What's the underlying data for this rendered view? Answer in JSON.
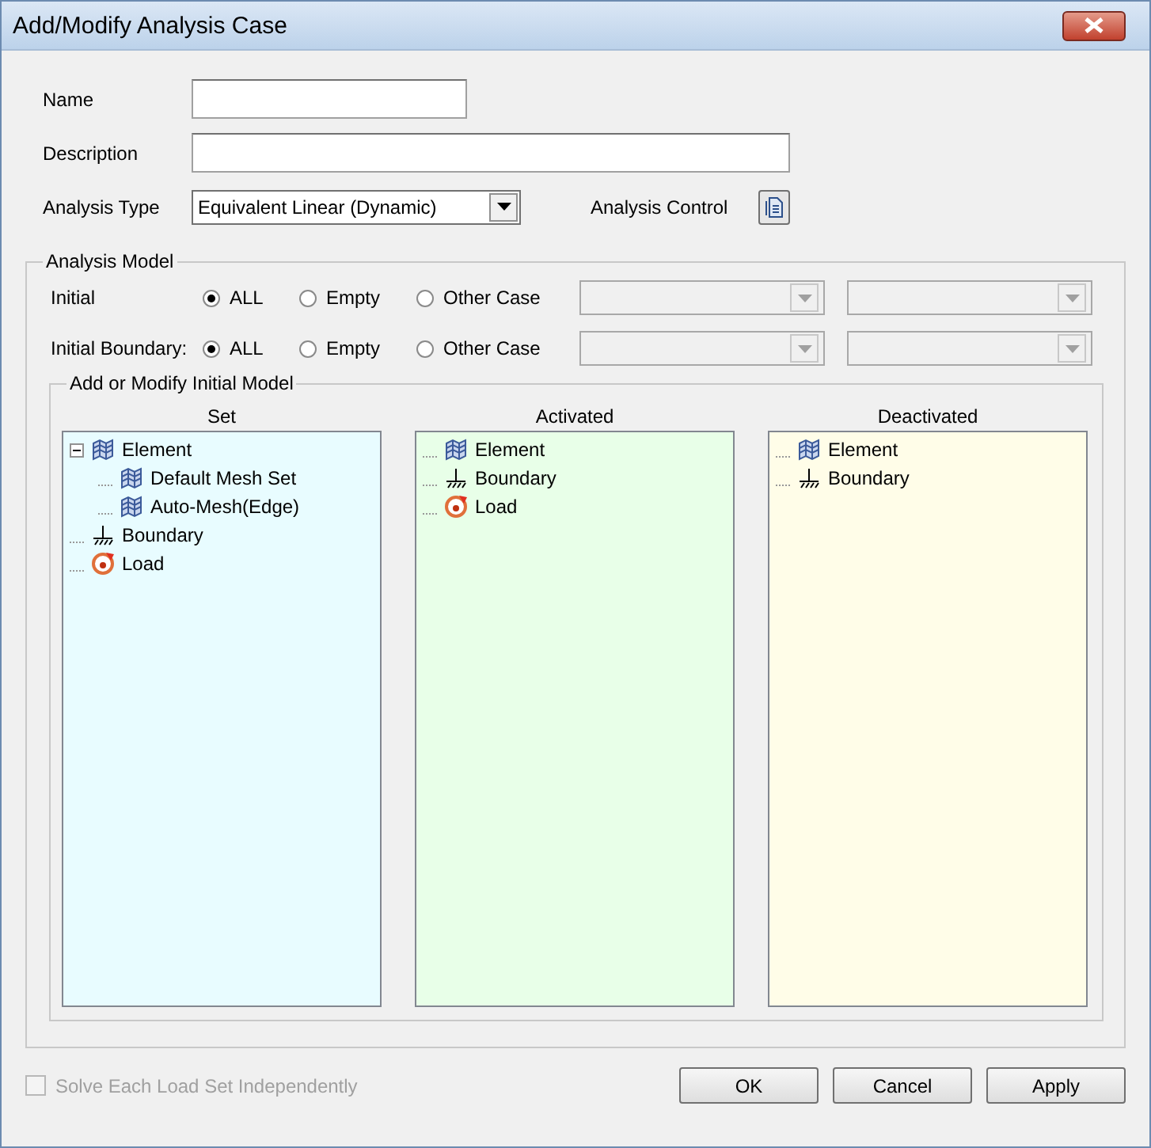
{
  "window": {
    "title": "Add/Modify Analysis Case"
  },
  "name_field": {
    "label": "Name"
  },
  "description_field": {
    "label": "Description"
  },
  "analysis_type": {
    "label": "Analysis Type",
    "value": "Equivalent Linear (Dynamic)"
  },
  "analysis_control": {
    "label": "Analysis Control"
  },
  "analysis_model": {
    "title": "Analysis Model",
    "rows": [
      {
        "label": "Initial",
        "options": [
          {
            "label": "ALL",
            "selected": true
          },
          {
            "label": "Empty",
            "selected": false
          },
          {
            "label": "Other Case",
            "selected": false
          }
        ]
      },
      {
        "label": "Initial Boundary:",
        "options": [
          {
            "label": "ALL",
            "selected": true
          },
          {
            "label": "Empty",
            "selected": false
          },
          {
            "label": "Other Case",
            "selected": false
          }
        ]
      }
    ]
  },
  "initial_model": {
    "title": "Add or Modify Initial Model",
    "panels": [
      {
        "title": "Set",
        "color": "#e8fcff",
        "items": [
          {
            "label": "Element",
            "kind": "element",
            "expanded": true,
            "children": [
              {
                "label": "Default Mesh Set",
                "kind": "element"
              },
              {
                "label": "Auto-Mesh(Edge)",
                "kind": "element"
              }
            ]
          },
          {
            "label": "Boundary",
            "kind": "boundary"
          },
          {
            "label": "Load",
            "kind": "load"
          }
        ]
      },
      {
        "title": "Activated",
        "color": "#e8ffe8",
        "items": [
          {
            "label": "Element",
            "kind": "element"
          },
          {
            "label": "Boundary",
            "kind": "boundary"
          },
          {
            "label": "Load",
            "kind": "load"
          }
        ]
      },
      {
        "title": "Deactivated",
        "color": "#fffde8",
        "items": [
          {
            "label": "Element",
            "kind": "element"
          },
          {
            "label": "Boundary",
            "kind": "boundary"
          }
        ]
      }
    ]
  },
  "solve_independently": {
    "label": "Solve Each Load Set Independently",
    "checked": false,
    "disabled": true
  },
  "buttons": [
    "OK",
    "Cancel",
    "Apply"
  ]
}
